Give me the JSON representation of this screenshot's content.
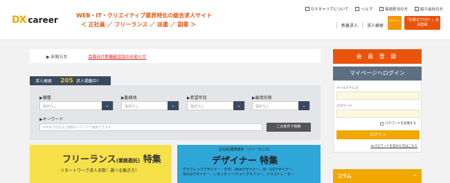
{
  "header": {
    "logo_mark": "DX",
    "logo_text": "career",
    "tagline1": "WEB・IT・クリエイティブ業界特化の総合求人サイト",
    "tagline2": "＜ 正社員 ／ フリーランス ／ 派遣 ／ 副業 ＞",
    "top_links": [
      "ＤＸキャリアについて",
      "ヘルプ",
      "採用担当の方",
      "紹介会社の方"
    ],
    "nav": [
      "新着求人",
      "求人検索"
    ],
    "login_label": "ログイン",
    "register_label": "「応募まで5分！」会員登録"
  },
  "news": {
    "label": "▶ お知らせ",
    "link": "会員向け新機能追加のお知らせ"
  },
  "search": {
    "tab_label": "求人検索",
    "count": "205",
    "count_suffix": "求人掲載中！",
    "fields": [
      {
        "label": "▶職種",
        "value": "指定なし"
      },
      {
        "label": "▶勤務地",
        "value": "指定なし"
      },
      {
        "label": "▶希望年収",
        "value": "指定なし"
      },
      {
        "label": "▶雇用形態",
        "value": "指定なし"
      }
    ],
    "keyword_label": "▶キーワード",
    "keyword_placeholder": "※半角で区切ると複数キーワードで検索できます",
    "submit": "この条件で検索"
  },
  "banners": {
    "freelance_title": "フリーランス",
    "freelance_sub_title": "(業務委託)",
    "freelance_tail": "特集",
    "freelance_sub": "リモートワーク求人多数！選べる働き方！",
    "designer_pre": "正社員/業務委託（フリーランス）",
    "designer_title": "デザイナー",
    "designer_tail": "特集",
    "designer_sub1": "グラフィックデザイナー・DTP、Webデザイナー、UI・UXデザイナー、",
    "designer_sub2": "3DCGデザイナー、レタッチャー/フォトグラファー、イラストレーター"
  },
  "sidebar": {
    "register": "会 員 登 録",
    "mypage": "マイページへログイン",
    "email_label": "メールアドレス",
    "password_label": "パスワード",
    "remember": "パスワードを記憶する",
    "login_btn": "ログイン",
    "forgot": "≫パスワードを忘れた方はこちら",
    "column": "コラム"
  },
  "colors": {
    "accent": "#e8540c",
    "brand": "#f0a800",
    "navy": "#3a4a5e"
  }
}
